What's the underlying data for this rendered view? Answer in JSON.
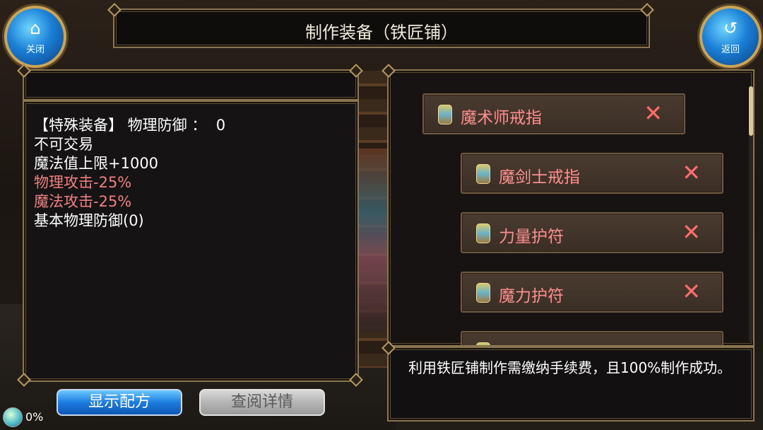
{
  "header": {
    "title": "制作装备（铁匠铺）",
    "close_label": "关闭",
    "back_label": "返回",
    "close_icon": "home-icon",
    "back_icon": "return-arrow-icon"
  },
  "details": {
    "lines": [
      {
        "text": "【特殊装备】 物理防御 ：  0",
        "color": "#ffffff"
      },
      {
        "text": "不可交易",
        "color": "#ffffff"
      },
      {
        "text": "魔法值上限+1000",
        "color": "#ffffff"
      },
      {
        "text": "物理攻击-25%",
        "color": "#f08080"
      },
      {
        "text": "魔法攻击-25%",
        "color": "#f08080"
      },
      {
        "text": "基本物理防御(0)",
        "color": "#ffffff"
      }
    ]
  },
  "recipe_list": {
    "items": [
      {
        "label": "魔术师戒指",
        "status_icon": "x-mark-icon"
      },
      {
        "label": "魔剑士戒指",
        "status_icon": "x-mark-icon"
      },
      {
        "label": "力量护符",
        "status_icon": "x-mark-icon"
      },
      {
        "label": "魔力护符",
        "status_icon": "x-mark-icon"
      }
    ],
    "x_glyph": "✕"
  },
  "notice": {
    "text": "利用铁匠铺制作需缴纳手续费，且100%制作成功。"
  },
  "buttons": {
    "show_recipe": "显示配方",
    "view_details": "查阅详情"
  },
  "status": {
    "progress": "0%"
  },
  "colors": {
    "accent_red": "#ff8f8f",
    "frame_gold": "#8a7550",
    "button_blue": "#1c7ce0"
  }
}
